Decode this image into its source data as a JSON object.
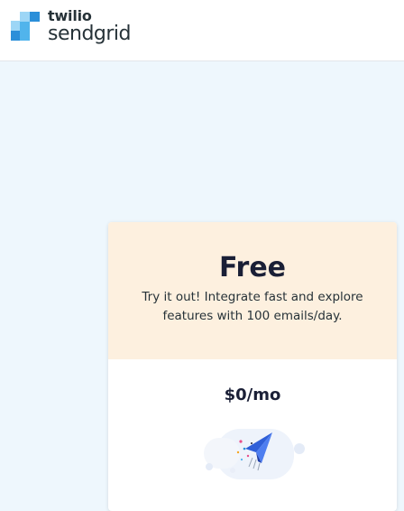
{
  "brand": {
    "line1": "twilio",
    "line2": "sendgrid"
  },
  "plan": {
    "name": "Free",
    "description": "Try it out! Integrate fast and explore features with 100 emails/day.",
    "price": "$0/mo",
    "illustration_icon": "paper-plane-icon"
  },
  "colors": {
    "page_background": "#eef7fd",
    "plan_header_background": "#fdf0df",
    "brand_blue": "#2b8fd9"
  }
}
